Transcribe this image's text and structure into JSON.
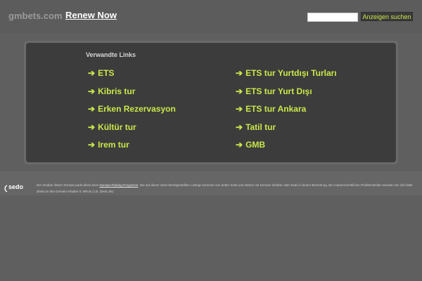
{
  "header": {
    "domain": "gmbets.com",
    "renew_label": "Renew Now",
    "search_button": "Anzeigen suchen"
  },
  "panel": {
    "title": "Verwandte Links",
    "links": [
      {
        "label": "ETS"
      },
      {
        "label": "Kibris tur"
      },
      {
        "label": "Erken Rezervasyon"
      },
      {
        "label": "Kültür tur"
      },
      {
        "label": "Irem tur"
      },
      {
        "label": "ETS tur Yurtdışı Turları"
      },
      {
        "label": "ETS tur Yurt Dışı"
      },
      {
        "label": "ETS tur Ankara"
      },
      {
        "label": "Tatil tur"
      },
      {
        "label": "GMB"
      }
    ],
    "arrow": "➔"
  },
  "footer": {
    "logo_text": "sedo",
    "text_before": "Der Inhaber dieser Domain parkt diese beim ",
    "link_text": "Domain-Parking-Programm",
    "text_after": ". Die auf dieser Seite bereitgestellten Listings kommen von dritter Seite und stehen mit Domain-Inhaber oder Sedo in keiner Beziehung. Bei markenrechtlichen Problemstellen wenden Sie sich bitte direkt an den Domain-Inhaber lt. Whois (z.B. Denic.de)."
  },
  "colors": {
    "accent_link": "#c9e84a",
    "page_background": "#5f5f5f",
    "panel_background": "#3c3c3c"
  }
}
